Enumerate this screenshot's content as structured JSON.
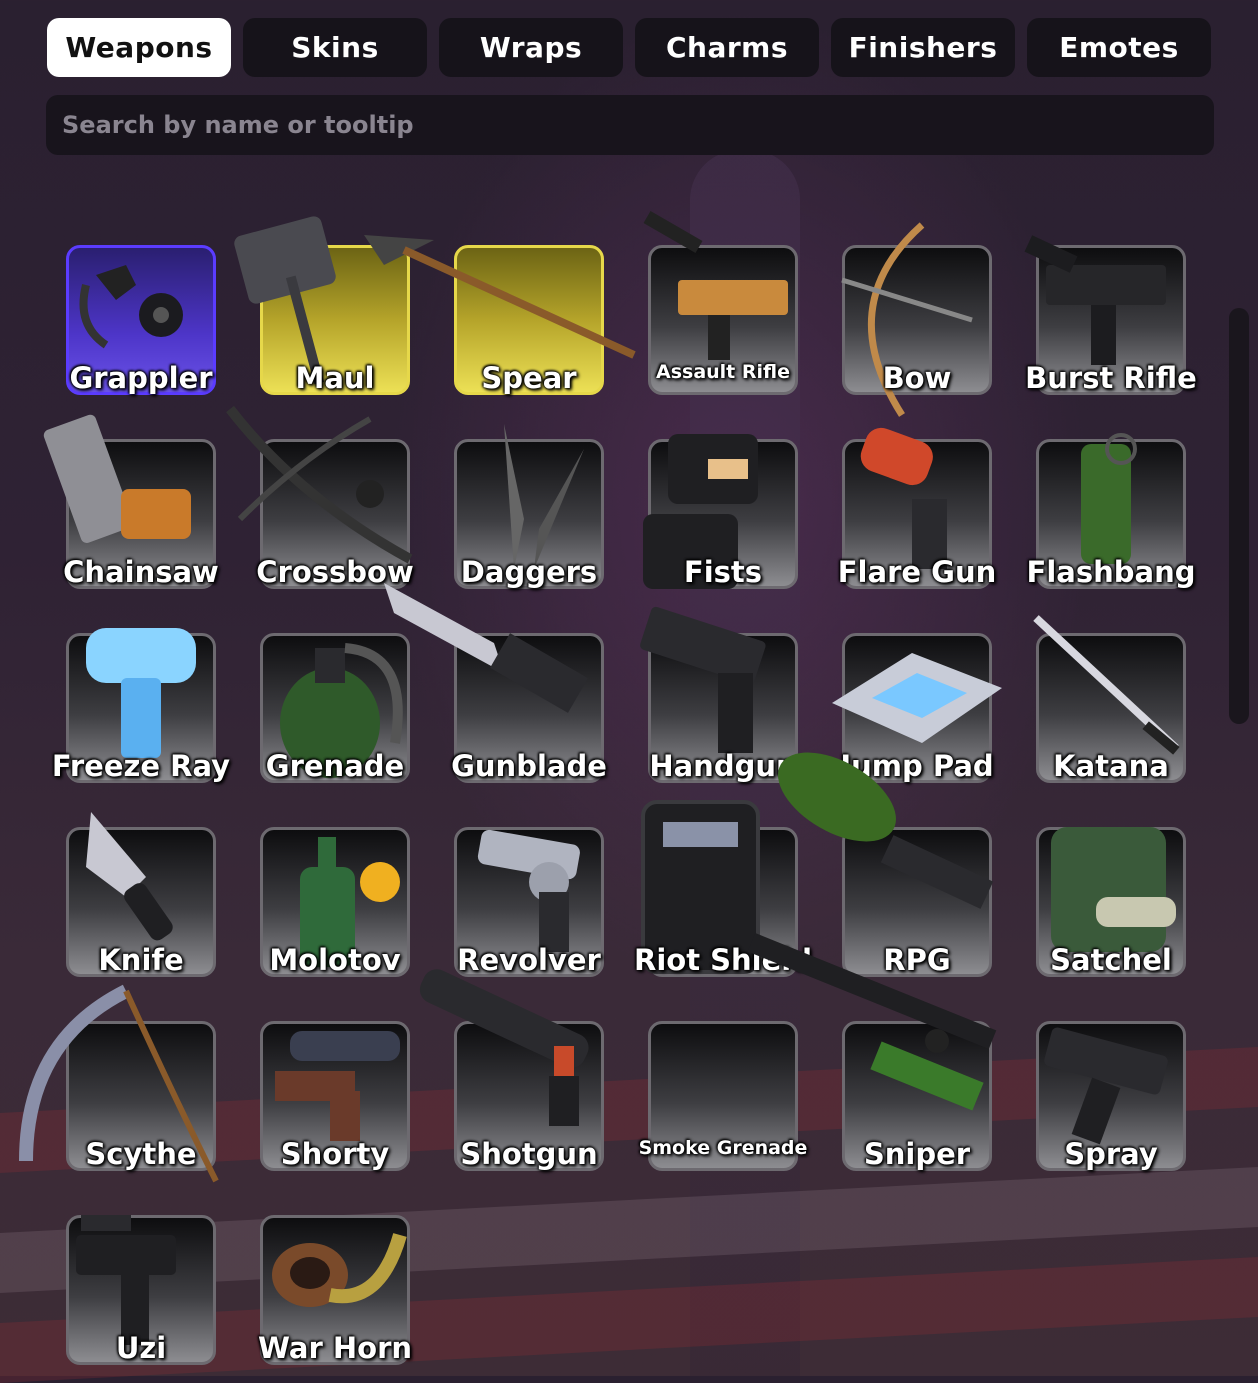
{
  "tabs": [
    {
      "label": "Weapons",
      "active": true
    },
    {
      "label": "Skins",
      "active": false
    },
    {
      "label": "Wraps",
      "active": false
    },
    {
      "label": "Charms",
      "active": false
    },
    {
      "label": "Finishers",
      "active": false
    },
    {
      "label": "Emotes",
      "active": false
    }
  ],
  "search": {
    "placeholder": "Search by name or tooltip",
    "value": ""
  },
  "colors": {
    "tile_purple": "#5b3cff",
    "tile_gold": "#e6d84a",
    "tab_active": "#ffffff"
  },
  "weapons": [
    {
      "name": "Grappler",
      "rarity": "purple",
      "icon": "grappler-icon"
    },
    {
      "name": "Maul",
      "rarity": "gold",
      "icon": "maul-icon"
    },
    {
      "name": "Spear",
      "rarity": "gold",
      "icon": "spear-icon"
    },
    {
      "name": "Assault Rifle",
      "rarity": "default",
      "icon": "assault-rifle-icon"
    },
    {
      "name": "Bow",
      "rarity": "default",
      "icon": "bow-icon"
    },
    {
      "name": "Burst Rifle",
      "rarity": "default",
      "icon": "burst-rifle-icon"
    },
    {
      "name": "Chainsaw",
      "rarity": "default",
      "icon": "chainsaw-icon"
    },
    {
      "name": "Crossbow",
      "rarity": "default",
      "icon": "crossbow-icon"
    },
    {
      "name": "Daggers",
      "rarity": "default",
      "icon": "daggers-icon"
    },
    {
      "name": "Fists",
      "rarity": "default",
      "icon": "fists-icon"
    },
    {
      "name": "Flare Gun",
      "rarity": "default",
      "icon": "flare-gun-icon"
    },
    {
      "name": "Flashbang",
      "rarity": "default",
      "icon": "flashbang-icon"
    },
    {
      "name": "Freeze Ray",
      "rarity": "default",
      "icon": "freeze-ray-icon"
    },
    {
      "name": "Grenade",
      "rarity": "default",
      "icon": "grenade-icon"
    },
    {
      "name": "Gunblade",
      "rarity": "default",
      "icon": "gunblade-icon"
    },
    {
      "name": "Handgun",
      "rarity": "default",
      "icon": "handgun-icon"
    },
    {
      "name": "Jump Pad",
      "rarity": "default",
      "icon": "jump-pad-icon"
    },
    {
      "name": "Katana",
      "rarity": "default",
      "icon": "katana-icon"
    },
    {
      "name": "Knife",
      "rarity": "default",
      "icon": "knife-icon"
    },
    {
      "name": "Molotov",
      "rarity": "default",
      "icon": "molotov-icon"
    },
    {
      "name": "Revolver",
      "rarity": "default",
      "icon": "revolver-icon"
    },
    {
      "name": "Riot Shield",
      "rarity": "default",
      "icon": "riot-shield-icon"
    },
    {
      "name": "RPG",
      "rarity": "default",
      "icon": "rpg-icon"
    },
    {
      "name": "Satchel",
      "rarity": "default",
      "icon": "satchel-icon"
    },
    {
      "name": "Scythe",
      "rarity": "default",
      "icon": "scythe-icon"
    },
    {
      "name": "Shorty",
      "rarity": "default",
      "icon": "shorty-icon"
    },
    {
      "name": "Shotgun",
      "rarity": "default",
      "icon": "shotgun-icon"
    },
    {
      "name": "Smoke Grenade",
      "rarity": "default",
      "icon": "smoke-grenade-icon"
    },
    {
      "name": "Sniper",
      "rarity": "default",
      "icon": "sniper-icon"
    },
    {
      "name": "Spray",
      "rarity": "default",
      "icon": "spray-icon"
    },
    {
      "name": "Uzi",
      "rarity": "default",
      "icon": "uzi-icon"
    },
    {
      "name": "War Horn",
      "rarity": "default",
      "icon": "war-horn-icon"
    }
  ]
}
